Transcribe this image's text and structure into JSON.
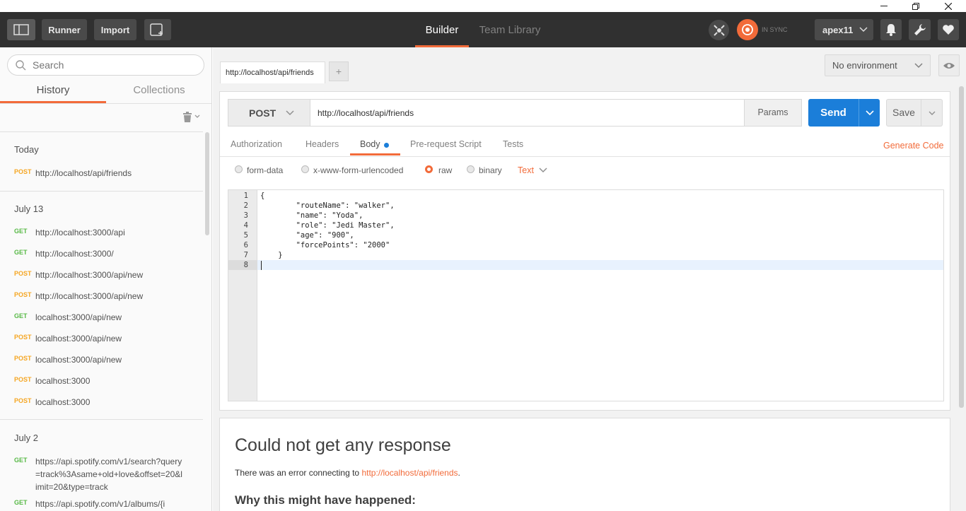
{
  "window": {
    "minimize": "—",
    "restore": "❐",
    "close": "✕"
  },
  "header": {
    "runner": "Runner",
    "import": "Import",
    "builder": "Builder",
    "team_library": "Team Library",
    "sync_status": "IN SYNC",
    "user": "apex11",
    "accent": "#f26b3a"
  },
  "sidebar": {
    "search_placeholder": "Search",
    "tabs": [
      "History",
      "Collections"
    ],
    "groups": [
      {
        "title": "Today",
        "items": [
          {
            "method": "POST",
            "url": "http://localhost/api/friends"
          }
        ]
      },
      {
        "title": "July 13",
        "items": [
          {
            "method": "GET",
            "url": "http://localhost:3000/api"
          },
          {
            "method": "GET",
            "url": "http://localhost:3000/"
          },
          {
            "method": "POST",
            "url": "http://localhost:3000/api/new"
          },
          {
            "method": "POST",
            "url": "http://localhost:3000/api/new"
          },
          {
            "method": "GET",
            "url": "localhost:3000/api/new"
          },
          {
            "method": "POST",
            "url": "localhost:3000/api/new"
          },
          {
            "method": "POST",
            "url": "localhost:3000/api/new"
          },
          {
            "method": "POST",
            "url": "localhost:3000"
          },
          {
            "method": "POST",
            "url": "localhost:3000"
          }
        ]
      },
      {
        "title": "July 2",
        "items": [
          {
            "method": "GET",
            "url": "https://api.spotify.com/v1/search?query=track%3Asame+old+love&offset=20&limit=20&type=track"
          },
          {
            "method": "GET",
            "url": "https://api.spotify.com/v1/albums/{i"
          }
        ]
      }
    ]
  },
  "main": {
    "request_tab": "http://localhost/api/friends",
    "add_tab": "+",
    "environment": "No environment",
    "method": "POST",
    "url": "http://localhost/api/friends",
    "params": "Params",
    "send": "Send",
    "save": "Save",
    "tabs": [
      "Authorization",
      "Headers",
      "Body",
      "Pre-request Script",
      "Tests"
    ],
    "generate_code": "Generate Code",
    "body_modes": [
      "form-data",
      "x-www-form-urlencoded",
      "raw",
      "binary"
    ],
    "raw_type": "Text",
    "code_lines": [
      "{",
      "        \"routeName\": \"walker\",",
      "        \"name\": \"Yoda\",",
      "        \"role\": \"Jedi Master\",",
      "        \"age\": \"900\",",
      "        \"forcePoints\": \"2000\"",
      "    }",
      ""
    ],
    "line_numbers": [
      "1",
      "2",
      "3",
      "4",
      "5",
      "6",
      "7",
      "8"
    ],
    "response_title": "Could not get any response",
    "error_prefix": "There was an error connecting to ",
    "error_link": "http://localhost/api/friends",
    "error_suffix": ".",
    "why_title": "Why this might have happened:"
  }
}
